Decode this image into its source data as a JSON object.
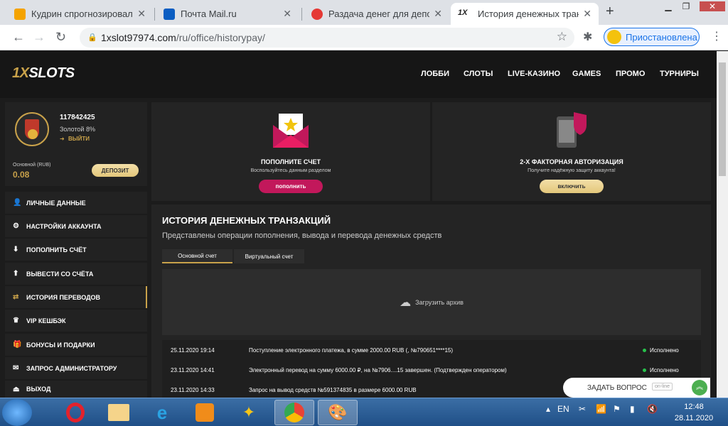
{
  "browser": {
    "tabs": [
      {
        "title": "Кудрин спрогнозировал р",
        "favicon_color": "#f4a300"
      },
      {
        "title": "Почта Mail.ru",
        "favicon_color": "#0a5dc2"
      },
      {
        "title": "Раздача денег для депози",
        "favicon_color": "#e53935"
      },
      {
        "title": "История денежных транза",
        "favicon_color": "#222222"
      }
    ],
    "url_host": "1xslot97974.com",
    "url_path": "/ru/office/historypay/",
    "profile_label": "Приостановлена"
  },
  "site": {
    "logo_x": "1X",
    "logo_rest": "SLOTS",
    "nav": [
      "ЛОББИ",
      "СЛОТЫ",
      "LIVE-КАЗИНО",
      "GAMES",
      "ПРОМО",
      "ТУРНИРЫ"
    ]
  },
  "user": {
    "id": "117842425",
    "level": "Золотой 8%",
    "logout": "ВЫЙТИ",
    "balance_label": "Основной (RUB)",
    "balance": "0.08",
    "deposit_btn": "ДЕПОЗИТ"
  },
  "menu": [
    {
      "label": "ЛИЧНЫЕ ДАННЫЕ",
      "icon": "user-icon"
    },
    {
      "label": "НАСТРОЙКИ АККАУНТА",
      "icon": "gear-icon"
    },
    {
      "label": "ПОПОЛНИТЬ СЧЁТ",
      "icon": "download-icon"
    },
    {
      "label": "ВЫВЕСТИ СО СЧЁТА",
      "icon": "upload-icon"
    },
    {
      "label": "ИСТОРИЯ ПЕРЕВОДОВ",
      "icon": "transfer-icon"
    },
    {
      "label": "VIP КЕШБЭК",
      "icon": "crown-icon"
    },
    {
      "label": "БОНУСЫ И ПОДАРКИ",
      "icon": "gift-icon"
    },
    {
      "label": "ЗАПРОС АДМИНИСТРАТОРУ",
      "icon": "mail-icon"
    },
    {
      "label": "ВЫХОД",
      "icon": "logout-icon"
    }
  ],
  "promo": {
    "deposit": {
      "title": "ПОПОЛНИТЕ СЧЕТ",
      "subtitle": "Воспользуйтесь данным разделом",
      "button": "пополнить"
    },
    "twofa": {
      "title": "2-Х ФАКТОРНАЯ АВТОРИЗАЦИЯ",
      "subtitle": "Получите надёжную защиту аккаунта!",
      "button": "включить"
    }
  },
  "history": {
    "title": "ИСТОРИЯ ДЕНЕЖНЫХ ТРАНЗАКЦИЙ",
    "subtitle": "Представлены операции пополнения, вывода и перевода денежных средств",
    "tabs": [
      "Основной счет",
      "Виртуальный счет"
    ],
    "archive": "Загрузить архив",
    "rows": [
      {
        "date": "25.11.2020 19:14",
        "desc": "Поступление электронного платежа, в сумме 2000.00 RUB (, №790651****15)",
        "status": "Исполнено"
      },
      {
        "date": "23.11.2020 14:41",
        "desc": "Электронный перевод на сумму 6000.00 ₽, на №7906....15 завершен. (Подтвержден оператором)",
        "status": "Исполнено"
      },
      {
        "date": "23.11.2020 14:33",
        "desc": "Запрос на вывод средств №591374835 в размере 6000.00 RUB",
        "status": ""
      }
    ]
  },
  "ask": {
    "label": "ЗАДАТЬ ВОПРОС",
    "status": "on-line"
  },
  "taskbar": {
    "lang": "EN",
    "time": "12:48",
    "date": "28.11.2020"
  },
  "colors": {
    "gold": "#c9a24a",
    "pink": "#c2185b",
    "green": "#27c24c"
  }
}
